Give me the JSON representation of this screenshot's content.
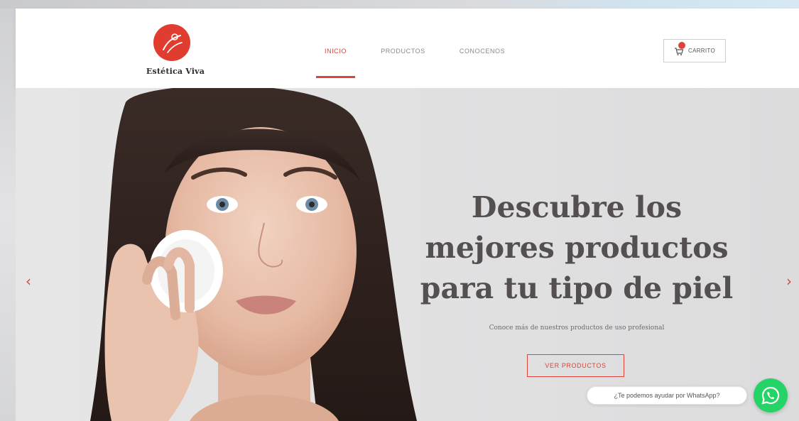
{
  "brand": {
    "name": "Estética Viva"
  },
  "nav": {
    "items": [
      {
        "label": "INICIO"
      },
      {
        "label": "PRODUCTOS"
      },
      {
        "label": "CONOCENOS"
      }
    ]
  },
  "cart": {
    "label": "CARRITO"
  },
  "hero": {
    "title_lines": [
      "Descubre los",
      "mejores productos",
      "para tu tipo de piel"
    ],
    "subtitle": "Conoce más de nuestros productos de uso profesional",
    "cta_label": "VER PRODUCTOS"
  },
  "whatsapp": {
    "bubble_text": "¿Te podemos ayudar por WhatsApp?"
  },
  "colors": {
    "accent": "#d9453a",
    "whatsapp": "#25d366"
  },
  "icons": [
    "logo-mark-icon",
    "cart-icon",
    "chevron-left-icon",
    "chevron-right-icon",
    "whatsapp-icon"
  ]
}
